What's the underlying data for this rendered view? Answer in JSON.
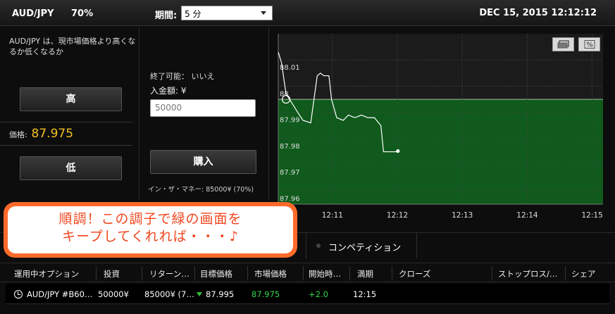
{
  "header": {
    "pair": "AUD/JPY",
    "payout": "70%",
    "period_label": "期間:",
    "period_value": "5 分",
    "datetime": "DEC 15, 2015 12:12:12"
  },
  "left_panel": {
    "description": "AUD/JPY は、現市場価格より高くなるか低くなるか",
    "high_label": "高",
    "price_label": "価格:",
    "price_value": "87.975",
    "low_label": "低"
  },
  "mid_panel": {
    "expire_text": "終了可能： いいえ",
    "deposit_label": "入金額: ¥",
    "amount_value": "50000",
    "buy_label": "購入",
    "money_note": "イン・ザ・マネー: 85000¥ (70%)"
  },
  "chart_data": {
    "type": "line",
    "ylim": [
      87.955,
      88.02
    ],
    "xlim": [
      "12:10:10",
      "12:15:10"
    ],
    "y_ticks": [
      "88.01",
      "88",
      "87.99",
      "87.98",
      "87.97",
      "87.96"
    ],
    "x_ticks": [
      "12:11",
      "12:12",
      "12:13",
      "12:14",
      "12:15"
    ],
    "strike_price": 87.995,
    "x_minutes": [
      0.0,
      0.05,
      0.12,
      0.2,
      0.3,
      0.38,
      0.5,
      0.6,
      0.65,
      0.7,
      0.78,
      0.82,
      0.9,
      1.0,
      1.08,
      1.18,
      1.28,
      1.38,
      1.48,
      1.58,
      1.62,
      1.7,
      1.75,
      1.82
    ],
    "values": [
      88.013,
      88.009,
      87.997,
      87.994,
      87.99,
      87.987,
      87.986,
      88.004,
      88.005,
      88.004,
      88.004,
      87.995,
      87.988,
      87.987,
      87.989,
      87.988,
      87.989,
      87.988,
      87.988,
      87.985,
      87.975,
      87.975,
      87.975,
      87.975
    ],
    "colors": {
      "above_zone": "#0f5a1c",
      "line": "#ffffff",
      "grid": "#4a4a4a"
    }
  },
  "chart_controls": {
    "buttons": [
      "window-icon",
      "percent-icon"
    ]
  },
  "tabs": {
    "competition_label": "コンペティション"
  },
  "table": {
    "headers": [
      "運用中オプション",
      "投資",
      "リターン…",
      "目標価格",
      "市場価格",
      "開始時…",
      "満期",
      "クローズ",
      "ストップロス/…",
      "シェア"
    ],
    "rows": [
      {
        "option": "AUD/JPY #B60…",
        "investment": "50000¥",
        "return": "85000¥ (7…",
        "target": "87.995",
        "market": "87.975",
        "start": "+2.0",
        "expiry": "12:15"
      }
    ]
  },
  "bubble": {
    "line1": "順調！この調子で緑の画面を",
    "line2": "キープしてくれれば・・・♪"
  }
}
